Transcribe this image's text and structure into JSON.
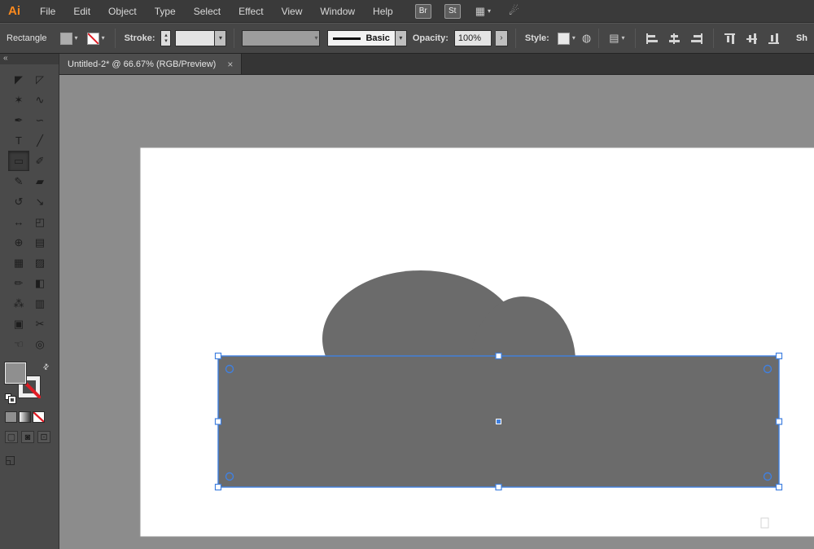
{
  "colors": {
    "selection_blue": "#4080e0",
    "shape_gray": "#6b6b6b",
    "canvas_gray": "#8c8c8c",
    "artboard_white": "#ffffff",
    "logo_orange": "#ff8a1d"
  },
  "icons": {
    "dropdown": "▾",
    "stepper_up": "▴",
    "stepper_down": "▾",
    "panel_collapse": "«",
    "swap": "⇄",
    "close": "×",
    "workspace_grid": "▦",
    "gpu": "☄",
    "globe": "◍",
    "doc_setup": "▤",
    "chevron_right": "›",
    "screen_mode": "◱"
  },
  "menubar": {
    "logo": "Ai",
    "items": [
      {
        "name": "menu-file",
        "label": "File"
      },
      {
        "name": "menu-edit",
        "label": "Edit"
      },
      {
        "name": "menu-object",
        "label": "Object"
      },
      {
        "name": "menu-type",
        "label": "Type"
      },
      {
        "name": "menu-select",
        "label": "Select"
      },
      {
        "name": "menu-effect",
        "label": "Effect"
      },
      {
        "name": "menu-view",
        "label": "View"
      },
      {
        "name": "menu-window",
        "label": "Window"
      },
      {
        "name": "menu-help",
        "label": "Help"
      }
    ],
    "br_label": "Br",
    "st_label": "St"
  },
  "control_bar": {
    "context_label": "Rectangle",
    "stroke_label": "Stroke:",
    "stroke_weight_value": "",
    "stroke_style_value": "Basic",
    "opacity_label": "Opacity:",
    "opacity_value": "100%",
    "style_label": "Style:",
    "right_clipped_label": "Sh",
    "align_icons_h": [
      {
        "name": "align-horizontal-left-icon",
        "cls": "ai-hl"
      },
      {
        "name": "align-horizontal-center-icon",
        "cls": "ai-hc"
      },
      {
        "name": "align-horizontal-right-icon",
        "cls": "ai-hr"
      }
    ],
    "align_icons_v": [
      {
        "name": "align-vertical-top-icon",
        "cls": "ai-vt"
      },
      {
        "name": "align-vertical-center-icon",
        "cls": "ai-vm"
      },
      {
        "name": "align-vertical-bottom-icon",
        "cls": "ai-vb"
      }
    ]
  },
  "document_tab": {
    "title": "Untitled-2* @ 66.67% (RGB/Preview)"
  },
  "tools": [
    {
      "name": "selection-tool",
      "glyph": "◤"
    },
    {
      "name": "direct-selection-tool",
      "glyph": "◸"
    },
    {
      "name": "magic-wand-tool",
      "glyph": "✶"
    },
    {
      "name": "lasso-tool",
      "glyph": "∿"
    },
    {
      "name": "pen-tool",
      "glyph": "✒"
    },
    {
      "name": "curvature-tool",
      "glyph": "∽"
    },
    {
      "name": "type-tool",
      "glyph": "T"
    },
    {
      "name": "line-segment-tool",
      "glyph": "╱"
    },
    {
      "name": "rectangle-tool",
      "glyph": "▭",
      "cls": "selected"
    },
    {
      "name": "paintbrush-tool",
      "glyph": "✐"
    },
    {
      "name": "shaper-tool",
      "glyph": "✎"
    },
    {
      "name": "eraser-tool",
      "glyph": "▰"
    },
    {
      "name": "rotate-tool",
      "glyph": "↺"
    },
    {
      "name": "scale-tool",
      "glyph": "↘"
    },
    {
      "name": "width-tool",
      "glyph": "↔"
    },
    {
      "name": "free-transform-tool",
      "glyph": "◰"
    },
    {
      "name": "shape-builder-tool",
      "glyph": "⊕"
    },
    {
      "name": "perspective-grid-tool",
      "glyph": "▤"
    },
    {
      "name": "mesh-tool",
      "glyph": "▦"
    },
    {
      "name": "gradient-tool",
      "glyph": "▨"
    },
    {
      "name": "eyedropper-tool",
      "glyph": "✏"
    },
    {
      "name": "blend-tool",
      "glyph": "◧"
    },
    {
      "name": "symbol-sprayer-tool",
      "glyph": "⁂"
    },
    {
      "name": "column-graph-tool",
      "glyph": "▥"
    },
    {
      "name": "artboard-tool",
      "glyph": "▣"
    },
    {
      "name": "slice-tool",
      "glyph": "✂"
    },
    {
      "name": "hand-tool",
      "glyph": "☜"
    },
    {
      "name": "zoom-tool",
      "glyph": "◎"
    }
  ],
  "tool_footer": {
    "draw_modes": [
      {
        "name": "draw-normal-button",
        "glyph": "▢"
      },
      {
        "name": "draw-behind-button",
        "glyph": "◙"
      },
      {
        "name": "draw-inside-button",
        "glyph": "⊡"
      }
    ]
  }
}
